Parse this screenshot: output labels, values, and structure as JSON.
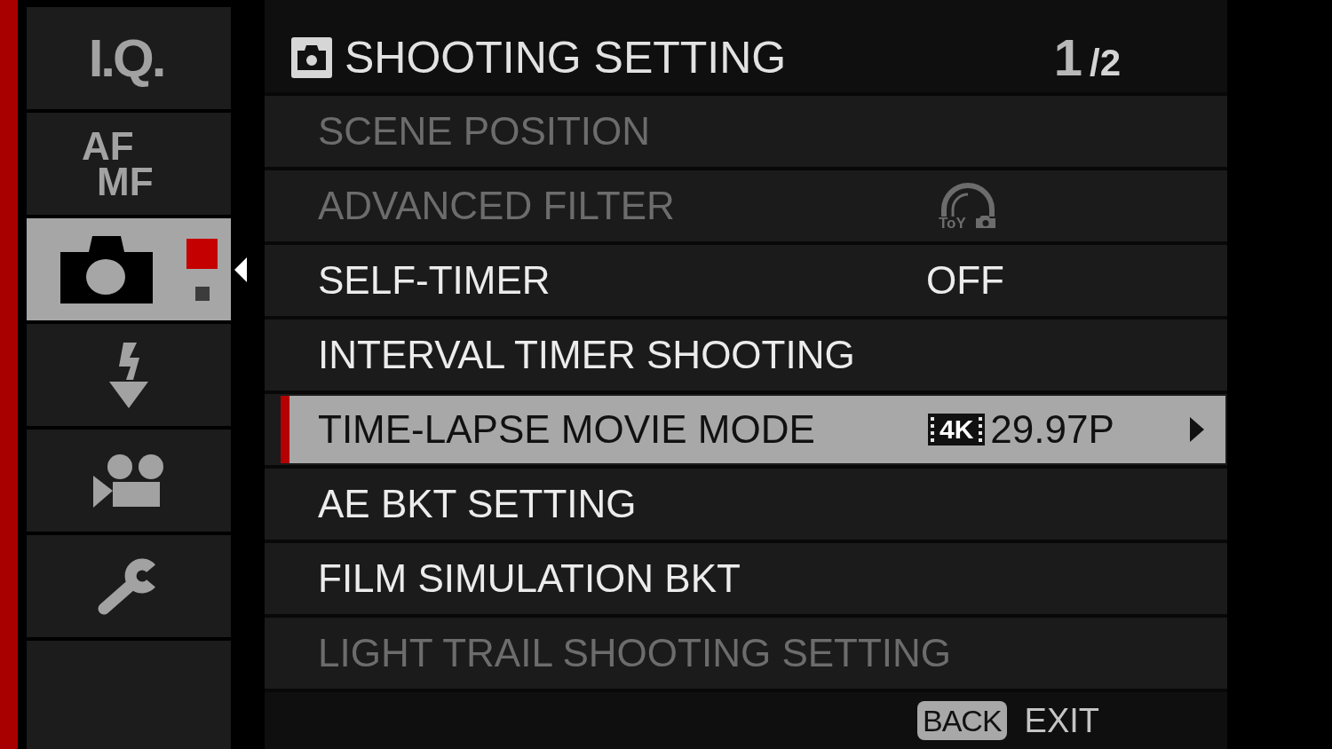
{
  "sidebar": {
    "tabs": [
      {
        "kind": "text",
        "label": "I.Q.",
        "selected": false
      },
      {
        "kind": "stacked-text",
        "lines": [
          "AF",
          "MF"
        ],
        "selected": false
      },
      {
        "kind": "camera",
        "selected": true,
        "pages": [
          {
            "selected": true
          },
          {
            "selected": false
          }
        ]
      },
      {
        "kind": "flash",
        "selected": false
      },
      {
        "kind": "movie",
        "selected": false
      },
      {
        "kind": "wrench",
        "selected": false
      }
    ]
  },
  "menu": {
    "title": "SHOOTING SETTING",
    "page": {
      "current": "1",
      "total": "/2"
    },
    "rows": [
      {
        "label": "SCENE POSITION",
        "disabled": true,
        "selected": false
      },
      {
        "label": "ADVANCED FILTER",
        "disabled": true,
        "selected": false,
        "value_symbol": {
          "kind": "toy-filter",
          "text": "ToY"
        }
      },
      {
        "label": "SELF-TIMER",
        "disabled": false,
        "selected": false,
        "value": "OFF"
      },
      {
        "label": "INTERVAL TIMER SHOOTING",
        "disabled": false,
        "selected": false
      },
      {
        "label": "TIME-LAPSE MOVIE MODE",
        "disabled": false,
        "selected": true,
        "value_symbol": {
          "kind": "resolution",
          "text": "4K"
        },
        "value": "29.97P"
      },
      {
        "label": "AE BKT SETTING",
        "disabled": false,
        "selected": false
      },
      {
        "label": "FILM SIMULATION BKT",
        "disabled": false,
        "selected": false
      },
      {
        "label": "LIGHT TRAIL SHOOTING SETTING",
        "disabled": true,
        "selected": false
      }
    ]
  },
  "footer": {
    "key": "BACK",
    "action": "EXIT"
  }
}
